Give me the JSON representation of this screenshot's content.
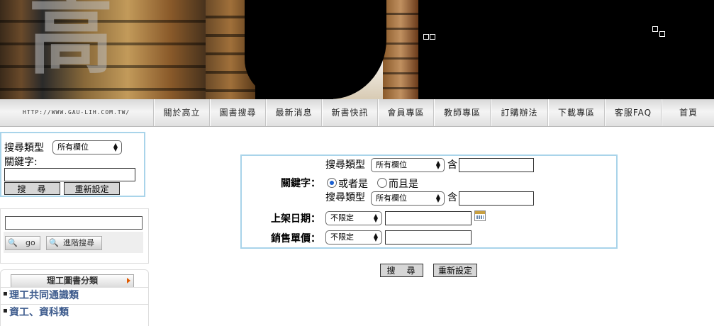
{
  "banner": {
    "logo_char": "高"
  },
  "nav": {
    "site_url": "HTTP://WWW.GAU-LIH.COM.TW/",
    "items": [
      "關於高立",
      "圖書搜尋",
      "最新消息",
      "新書快訊",
      "會員專區",
      "教師專區",
      "訂購辦法",
      "下載專區",
      "客服FAQ",
      "首頁"
    ]
  },
  "quick_search": {
    "type_label": "搜尋類型",
    "type_value": "所有欄位",
    "keyword_label": "關鍵字:",
    "keyword_value": "",
    "search_label": "搜　尋",
    "reset_label": "重新設定"
  },
  "go_panel": {
    "input_value": "",
    "go_label": "go",
    "advanced_label": "進階搜尋"
  },
  "categories": {
    "header": "理工圖書分類",
    "items": [
      "理工共同通識類",
      "資工、資科類"
    ]
  },
  "advanced_search": {
    "type_label_1": "搜尋類型",
    "type_value_1": "所有欄位",
    "contains_1": "含",
    "keyword_label": "關鍵字：",
    "radio_or": "或者是",
    "radio_and": "而且是",
    "radio_selected": "或者是",
    "type_label_2": "搜尋類型",
    "type_value_2": "所有欄位",
    "contains_2": "含",
    "date_label": "上架日期：",
    "date_value": "不限定",
    "price_label": "銷售單價：",
    "price_value": "不限定",
    "search_label": "搜　尋",
    "reset_label": "重新設定"
  },
  "colors": {
    "box_border": "#a9d4ea",
    "category_text": "#3c5a8c",
    "radio_selected": "#1a5fd0"
  }
}
